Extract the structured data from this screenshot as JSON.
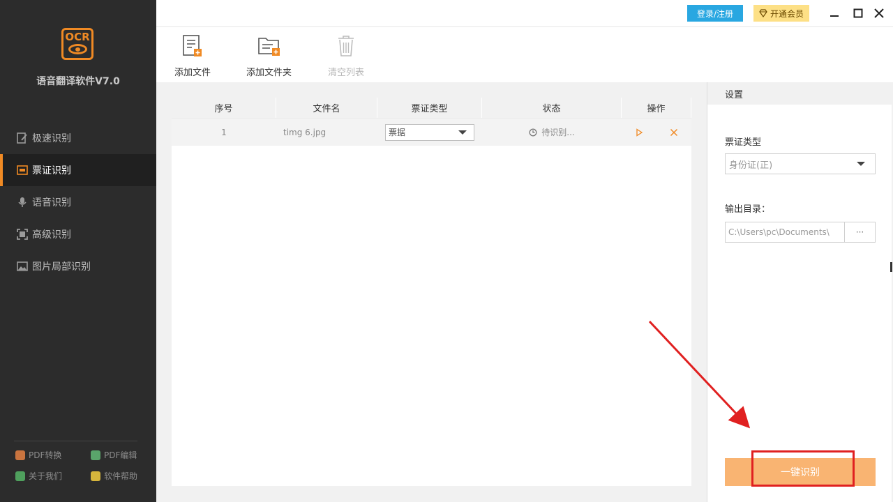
{
  "app": {
    "logo_text": "OCR",
    "title": "语音翻译软件V7.0"
  },
  "sidebar": {
    "items": [
      {
        "label": "极速识别",
        "active": false
      },
      {
        "label": "票证识别",
        "active": true
      },
      {
        "label": "语音识别",
        "active": false
      },
      {
        "label": "高级识别",
        "active": false
      },
      {
        "label": "图片局部识别",
        "active": false
      }
    ],
    "links": [
      {
        "label": "PDF转换",
        "color": "#c9743f"
      },
      {
        "label": "PDF编辑",
        "color": "#5aa56b"
      },
      {
        "label": "关于我们",
        "color": "#4fa05d"
      },
      {
        "label": "软件帮助",
        "color": "#d6b53c"
      }
    ]
  },
  "titlebar": {
    "login_label": "登录/注册",
    "vip_label": "开通会员"
  },
  "toolbar": {
    "add_file": "添加文件",
    "add_folder": "添加文件夹",
    "clear_list": "清空列表"
  },
  "table": {
    "headers": [
      "序号",
      "文件名",
      "票证类型",
      "状态",
      "操作"
    ],
    "rows": [
      {
        "index": "1",
        "filename": "timg 6.jpg",
        "type": "票据",
        "status": "待识别..."
      }
    ]
  },
  "settings": {
    "header": "设置",
    "type_label": "票证类型",
    "type_value": "身份证(正)",
    "output_label": "输出目录：",
    "output_value": "C:\\Users\\pc\\Documents\\",
    "browse_label": "···",
    "run_label": "一键识别"
  },
  "colors": {
    "accent": "#f08a24",
    "login": "#29a7e1",
    "vip": "#fde086",
    "run_button": "#f9b472",
    "annotation": "#e02020"
  }
}
